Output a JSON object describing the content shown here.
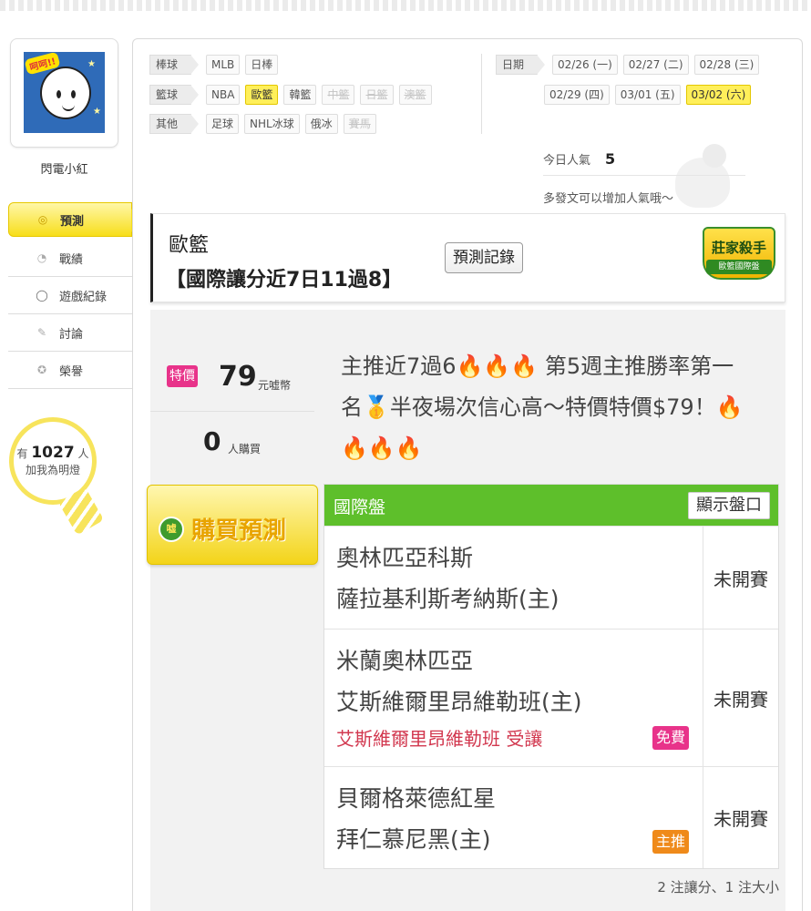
{
  "user": {
    "name": "閃電小紅",
    "avatar_icon": "cartoon-avatar",
    "avatar_bubble": "呵呵!!"
  },
  "side_nav": [
    {
      "label": "預測",
      "icon": "target-icon",
      "active": true
    },
    {
      "label": "戰績",
      "icon": "record-icon",
      "active": false
    },
    {
      "label": "遊戲紀錄",
      "icon": "circle-icon",
      "active": false
    },
    {
      "label": "討論",
      "icon": "pencil-icon",
      "active": false
    },
    {
      "label": "榮譽",
      "icon": "medal-icon",
      "active": false
    }
  ],
  "bulb": {
    "prefix": "有",
    "count": "1027",
    "suffix": "人",
    "line2": "加我為明燈"
  },
  "filters": {
    "baseball": {
      "label": "棒球",
      "items": [
        "MLB",
        "日棒"
      ]
    },
    "basketball": {
      "label": "籃球",
      "items": [
        "NBA",
        "歐籃",
        "韓籃",
        "中籃",
        "日籃",
        "澳籃"
      ]
    },
    "other": {
      "label": "其他",
      "items": [
        "足球",
        "NHL冰球",
        "俄冰",
        "賽馬"
      ]
    },
    "date": {
      "label": "日期",
      "items": [
        "02/26 (一)",
        "02/27 (二)",
        "02/28 (三)",
        "02/29 (四)",
        "03/01 (五)",
        "03/02 (六)"
      ]
    }
  },
  "popularity": {
    "label": "今日人氣",
    "value": "5",
    "note": "多發文可以增加人氣哦～"
  },
  "prediction": {
    "category": "歐籃",
    "title": "【國際讓分近7日11過8】",
    "record_button": "預測記錄",
    "badge_title": "莊家殺手",
    "badge_sub": "歐籃國際盤"
  },
  "offer": {
    "tag": "特價",
    "price": "79",
    "unit": "元嘘幣",
    "buyers": "0",
    "buyers_unit": "人購買",
    "description": "主推近7過6🔥🔥🔥 第5週主推勝率第一名🥇半夜場次信心高～特價特價$79！🔥🔥🔥🔥",
    "buy_button": "購買預測",
    "coin_label": "嘘"
  },
  "market": {
    "name": "國際盤",
    "show_button": "顯示盤口",
    "games": [
      {
        "away": "奧林匹亞科斯",
        "home": "薩拉基利斯考納斯(主)",
        "pick": "",
        "label": "",
        "status": "未開賽"
      },
      {
        "away": "米蘭奧林匹亞",
        "home": "艾斯維爾里昂維勒班(主)",
        "pick": "艾斯維爾里昂維勒班 受讓",
        "label": "免費",
        "status": "未開賽"
      },
      {
        "away": "貝爾格萊德紅星",
        "home": "拜仁慕尼黑(主)",
        "pick": "",
        "label": "主推",
        "status": "未開賽"
      }
    ]
  },
  "summary": "2 注讓分、1 注大小",
  "colors": {
    "accent_yellow": "#f7de1a",
    "market_green": "#5ebf2b",
    "pink": "#e8338a",
    "orange": "#ef8a1a",
    "pick_red": "#d2384f"
  }
}
